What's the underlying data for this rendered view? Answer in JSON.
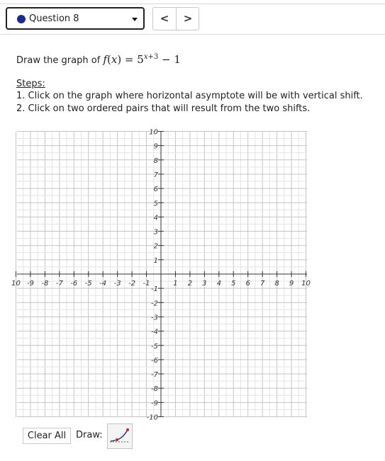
{
  "header": {
    "question_label": "Question 8",
    "prev_glyph": "<",
    "next_glyph": ">",
    "status_dot_color": "#1a2a9c"
  },
  "problem": {
    "prompt_prefix": "Draw the graph of",
    "function_name": "f",
    "variable": "x",
    "base": "5",
    "exponent_shift": "+3",
    "vertical_shift": "− 1"
  },
  "steps": {
    "title": "Steps:",
    "items": [
      "1. Click on the graph where horizontal asymptote will be with vertical shift.",
      "2. Click on two ordered pairs that will result from the two shifts."
    ]
  },
  "graph": {
    "x_range": [
      -10,
      10
    ],
    "y_range": [
      -10,
      10
    ],
    "minor_step": 0.5,
    "major_step": 1,
    "x_tick_labels": [
      "10",
      "-9",
      "-8",
      "-7",
      "-6",
      "-5",
      "-4",
      "-3",
      "-2",
      "-1",
      "1",
      "2",
      "3",
      "4",
      "5",
      "6",
      "7",
      "8",
      "9",
      "10"
    ],
    "y_tick_labels": [
      "10",
      "9",
      "8",
      "7",
      "6",
      "5",
      "4",
      "3",
      "2",
      "1",
      "-1",
      "-2",
      "-3",
      "-4",
      "-5",
      "-6",
      "-7",
      "-8",
      "-9",
      "-10"
    ]
  },
  "toolbar": {
    "clear_label": "Clear All",
    "draw_label": "Draw:",
    "draw_tool_icon": "exponential-curve-icon"
  }
}
